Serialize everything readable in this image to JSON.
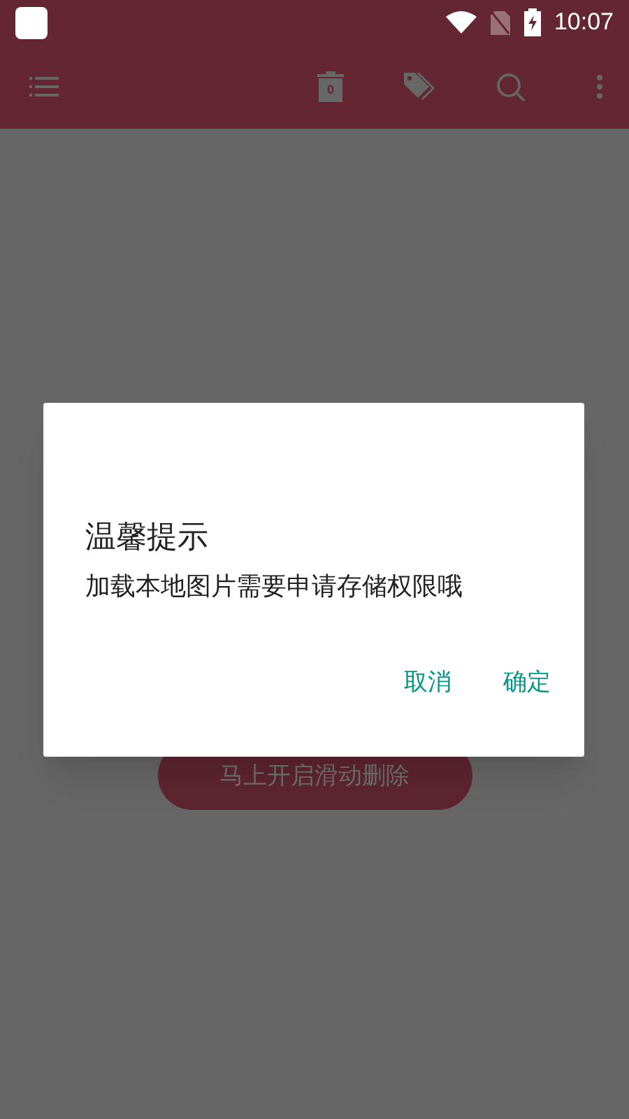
{
  "status_bar": {
    "time": "10:07"
  },
  "toolbar": {
    "trash_count": "0"
  },
  "main_button": {
    "label": "马上开启滑动删除"
  },
  "dialog": {
    "title": "温馨提示",
    "message": "加载本地图片需要申请存储权限哦",
    "buttons": [
      "取消",
      "确定"
    ]
  }
}
